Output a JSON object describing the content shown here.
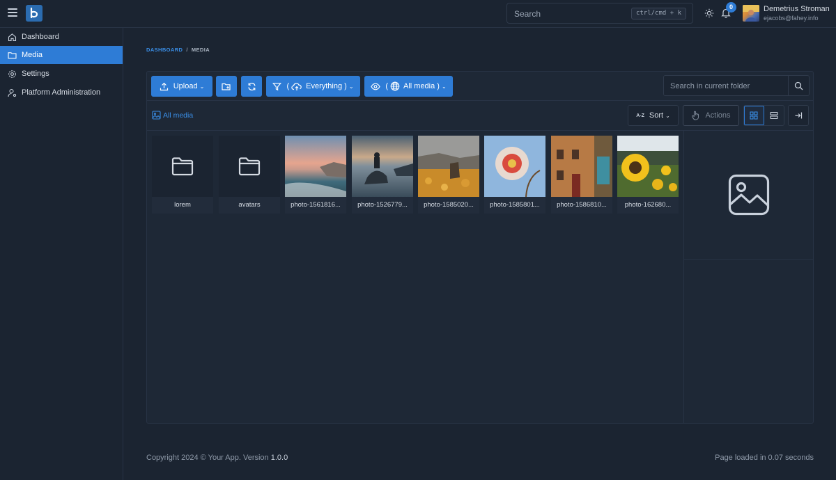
{
  "topbar": {
    "search_placeholder": "Search",
    "search_shortcut": "ctrl/cmd + k",
    "notification_count": "0",
    "user_name": "Demetrius Stroman",
    "user_email": "ejacobs@fahey.info"
  },
  "sidebar": {
    "items": [
      {
        "label": "Dashboard",
        "icon": "home-icon",
        "active": false
      },
      {
        "label": "Media",
        "icon": "folder-icon",
        "active": true
      },
      {
        "label": "Settings",
        "icon": "gear-icon",
        "active": false
      },
      {
        "label": "Platform Administration",
        "icon": "user-gear-icon",
        "active": false
      }
    ]
  },
  "breadcrumb": {
    "root": "DASHBOARD",
    "separator": "/",
    "current": "MEDIA"
  },
  "toolbar": {
    "upload_label": "Upload",
    "filter_label": "Everything )",
    "filter_open": "(",
    "visibility_label": "All media )",
    "visibility_open": "(",
    "folder_search_placeholder": "Search in current folder",
    "all_media_link": "All media",
    "sort_label": "Sort",
    "sort_prefix": "A-Z",
    "actions_label": "Actions"
  },
  "items": [
    {
      "name": "lorem",
      "type": "folder"
    },
    {
      "name": "avatars",
      "type": "folder"
    },
    {
      "name": "photo-1561816...",
      "type": "image"
    },
    {
      "name": "photo-1526779...",
      "type": "image"
    },
    {
      "name": "photo-1585020...",
      "type": "image"
    },
    {
      "name": "photo-1585801...",
      "type": "image"
    },
    {
      "name": "photo-1586810...",
      "type": "image"
    },
    {
      "name": "photo-162680...",
      "type": "image"
    }
  ],
  "footer": {
    "copyright": "Copyright 2024 © Your App. Version ",
    "version": "1.0.0",
    "load_time": "Page loaded in 0.07 seconds"
  },
  "colors": {
    "accent": "#2e7cd6",
    "background": "#1b2431",
    "panel": "#1e2836"
  }
}
